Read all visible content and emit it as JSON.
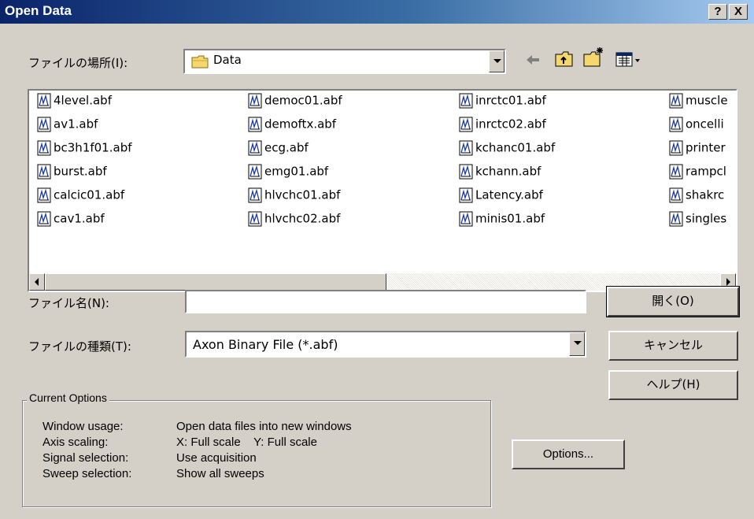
{
  "window": {
    "title": "Open Data",
    "help_btn": "?",
    "close_btn": "X"
  },
  "location": {
    "label": "ファイルの場所(I):",
    "value": "Data"
  },
  "files": [
    [
      "4level.abf",
      "av1.abf",
      "bc3h1f01.abf",
      "burst.abf",
      "calcic01.abf",
      "cav1.abf"
    ],
    [
      "democ01.abf",
      "demoftx.abf",
      "ecg.abf",
      "emg01.abf",
      "hlvchc01.abf",
      "hlvchc02.abf"
    ],
    [
      "inrctc01.abf",
      "inrctc02.abf",
      "kchanc01.abf",
      "kchann.abf",
      "Latency.abf",
      "minis01.abf"
    ],
    [
      "muscle",
      "oncelli",
      "printer",
      "rampcl",
      "shakrc",
      "singles"
    ]
  ],
  "filename": {
    "label": "ファイル名(N):",
    "value": ""
  },
  "filetype": {
    "label": "ファイルの種類(T):",
    "value": "Axon Binary File (*.abf)"
  },
  "buttons": {
    "open": "開く(O)",
    "cancel": "キャンセル",
    "help": "ヘルプ(H)",
    "options": "Options..."
  },
  "current_options": {
    "title": "Current Options",
    "rows": [
      {
        "label": "Window usage:",
        "value": "Open data files into new windows"
      },
      {
        "label": "Axis scaling:",
        "value": "X: Full scale    Y: Full scale"
      },
      {
        "label": "Signal selection:",
        "value": "Use acquisition"
      },
      {
        "label": "Sweep selection:",
        "value": "Show all sweeps"
      }
    ]
  }
}
